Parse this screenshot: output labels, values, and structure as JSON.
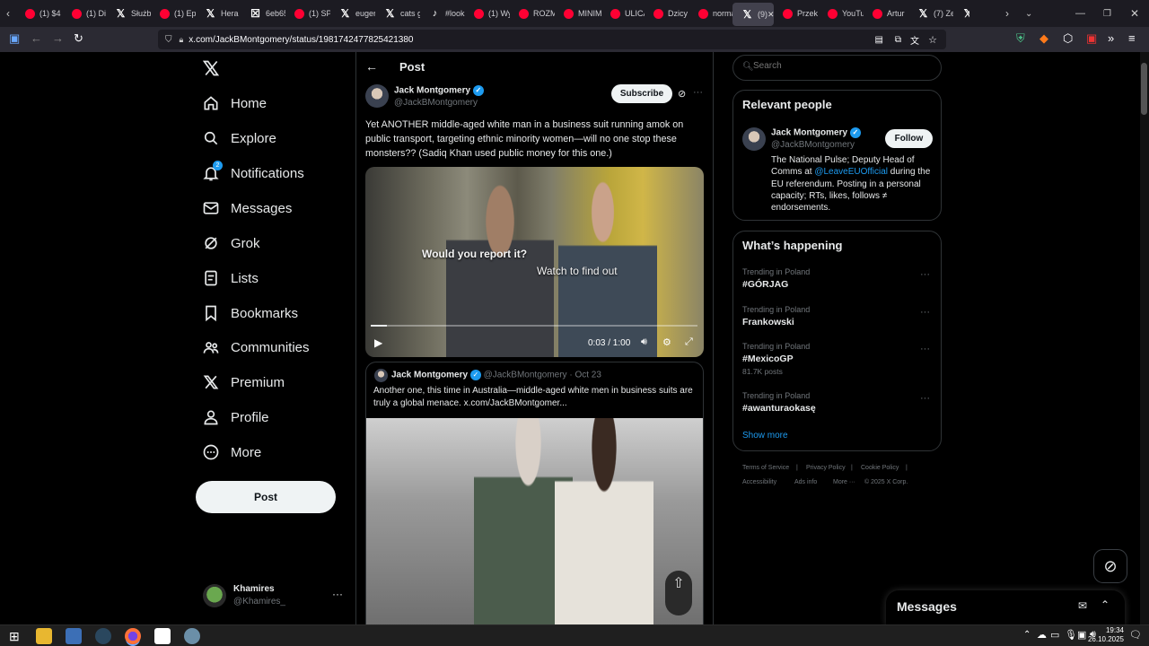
{
  "tabs": [
    {
      "label": "(1) $4",
      "icon": "youtube"
    },
    {
      "label": "(1) Di",
      "icon": "youtube"
    },
    {
      "label": "Służb",
      "icon": "x"
    },
    {
      "label": "(1) Ep",
      "icon": "youtube"
    },
    {
      "label": "Hera",
      "icon": "x"
    },
    {
      "label": "6eb65",
      "icon": "x-box"
    },
    {
      "label": "(1) SP",
      "icon": "youtube"
    },
    {
      "label": "euger",
      "icon": "x"
    },
    {
      "label": "cats g",
      "icon": "x"
    },
    {
      "label": "#look",
      "icon": "tiktok"
    },
    {
      "label": "(1) Wy",
      "icon": "youtube"
    },
    {
      "label": "ROZM",
      "icon": "youtube"
    },
    {
      "label": "MINIM",
      "icon": "youtube"
    },
    {
      "label": "ULICA",
      "icon": "youtube"
    },
    {
      "label": "Dzicy",
      "icon": "youtube"
    },
    {
      "label": "norma",
      "icon": "youtube"
    },
    {
      "label": "(9)",
      "icon": "x"
    },
    {
      "label": "Przek",
      "icon": "youtube"
    },
    {
      "label": "YouTu",
      "icon": "youtube"
    },
    {
      "label": "Artur",
      "icon": "youtube"
    },
    {
      "label": "(7) Ze",
      "icon": "x"
    },
    {
      "label": "",
      "icon": "x"
    }
  ],
  "url": "x.com/JackBMontgomery/status/1981742477825421380",
  "nav": {
    "items": [
      "Home",
      "Explore",
      "Notifications",
      "Messages",
      "Grok",
      "Lists",
      "Bookmarks",
      "Communities",
      "Premium",
      "Profile",
      "More"
    ],
    "post_button": "Post",
    "notifications_badge": "2",
    "account_name": "Khamires",
    "account_handle": "@Khamires_"
  },
  "post": {
    "header": "Post",
    "author_name": "Jack Montgomery",
    "author_handle": "@JackBMontgomery",
    "subscribe_label": "Subscribe",
    "text": "Yet ANOTHER middle-aged white man in a business suit running amok on public transport, targeting ethnic minority women—will no one stop these monsters?? (Sadiq Khan used public money for this one.)",
    "video_caption_1": "Would you report it?",
    "video_caption_2": "Watch to find out",
    "video_time": "0:03 / 1:00",
    "video_progress": 0.05
  },
  "quoted": {
    "author_name": "Jack Montgomery",
    "author_handle": "@JackBMontgomery",
    "date": "· Oct 23",
    "text": "Another one, this time in Australia—middle-aged white men in business suits are truly a global menace.  x.com/JackBMontgomer..."
  },
  "search": {
    "placeholder": "Search"
  },
  "relevant": {
    "title": "Relevant people",
    "name": "Jack Montgomery",
    "handle": "@JackBMontgomery",
    "follow_label": "Follow",
    "bio_1": "The National Pulse; Deputy Head of Comms at ",
    "bio_mention": "@LeaveEUOfficial",
    "bio_2": " during the EU referendum. Posting in a personal capacity; RTs, likes, follows ≠ endorsements."
  },
  "happening": {
    "title": "What’s happening",
    "trends": [
      {
        "context": "Trending in Poland",
        "topic": "#GÓRJAG",
        "posts": ""
      },
      {
        "context": "Trending in Poland",
        "topic": "Frankowski",
        "posts": ""
      },
      {
        "context": "Trending in Poland",
        "topic": "#MexicoGP",
        "posts": "81.7K posts"
      },
      {
        "context": "Trending in Poland",
        "topic": "#awanturaokasę",
        "posts": ""
      }
    ],
    "show_more": "Show more"
  },
  "footer": [
    "Terms of Service",
    "|",
    "Privacy Policy",
    "|",
    "Cookie Policy",
    "|",
    "Accessibility",
    "Ads info",
    "More ···",
    "© 2025 X Corp."
  ],
  "messages_drawer": "Messages",
  "clock": {
    "time": "19:34",
    "date": "26.10.2025"
  },
  "colors": {
    "accent": "#1d9bf0",
    "background": "#000000",
    "border": "#2f3336"
  }
}
